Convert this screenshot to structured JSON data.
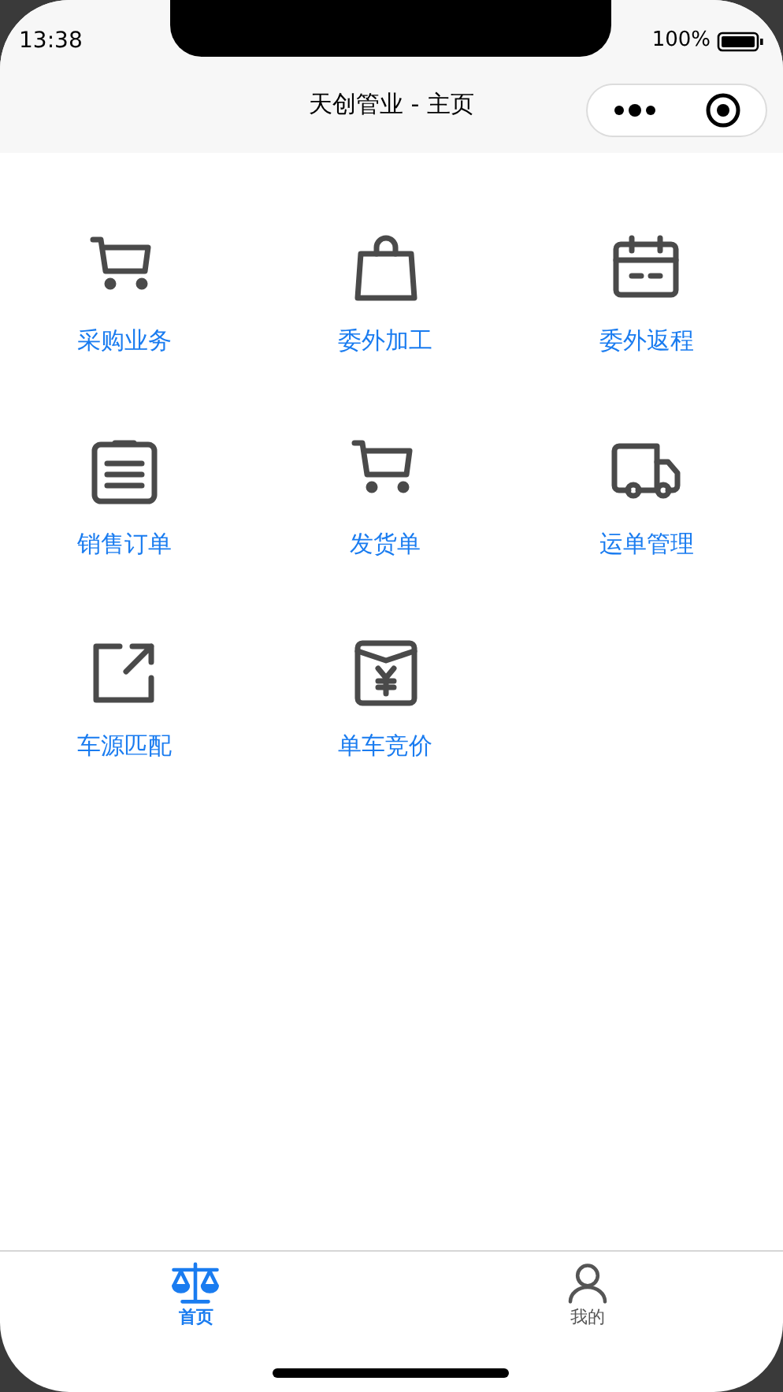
{
  "status_bar": {
    "time": "13:38",
    "battery": "100%"
  },
  "nav_bar": {
    "title": "天创管业 - 主页"
  },
  "menu": [
    {
      "label": "采购业务",
      "kind": "cart"
    },
    {
      "label": "委外加工",
      "kind": "bag"
    },
    {
      "label": "委外返程",
      "kind": "calendar"
    },
    {
      "label": "销售订单",
      "kind": "list"
    },
    {
      "label": "发货单",
      "kind": "cart"
    },
    {
      "label": "运单管理",
      "kind": "truck"
    },
    {
      "label": "车源匹配",
      "kind": "share"
    },
    {
      "label": "单车竞价",
      "kind": "yen"
    }
  ],
  "tab_bar": [
    {
      "label": "首页",
      "kind": "scale",
      "selected": true
    },
    {
      "label": "我的",
      "kind": "person",
      "selected": false
    }
  ]
}
